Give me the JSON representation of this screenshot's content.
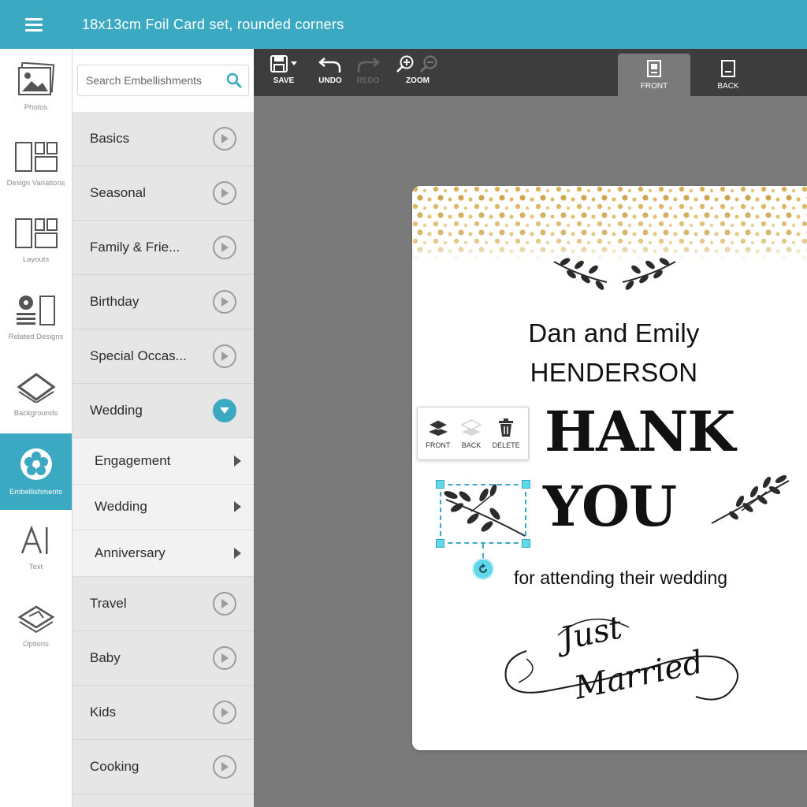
{
  "app": {
    "title": "18x13cm Foil Card set, rounded corners"
  },
  "rail": [
    {
      "label": "Photos",
      "icon": "photos-icon"
    },
    {
      "label": "Design Variations",
      "icon": "design-variations-icon"
    },
    {
      "label": "Layouts",
      "icon": "layouts-icon"
    },
    {
      "label": "Related Designs",
      "icon": "related-designs-icon"
    },
    {
      "label": "Backgrounds",
      "icon": "backgrounds-icon"
    },
    {
      "label": "Embellishments",
      "icon": "flower-icon",
      "active": true
    },
    {
      "label": "Text",
      "icon": "text-icon"
    },
    {
      "label": "Options",
      "icon": "options-icon"
    }
  ],
  "search": {
    "placeholder": "Search Embellishments"
  },
  "categories": {
    "basics": "Basics",
    "seasonal": "Seasonal",
    "family": "Family & Frie...",
    "birthday": "Birthday",
    "special": "Special Occas...",
    "wedding": "Wedding",
    "travel": "Travel",
    "baby": "Baby",
    "kids": "Kids",
    "cooking": "Cooking"
  },
  "wedding_sub": {
    "engagement": "Engagement",
    "wedding": "Wedding",
    "anniversary": "Anniversary"
  },
  "toolbar": {
    "save": "SAVE",
    "undo": "UNDO",
    "redo": "REDO",
    "zoom": "ZOOM",
    "front": "FRONT",
    "back": "BACK"
  },
  "card": {
    "line1": "Dan and Emily",
    "line2": "HENDERSON",
    "thank": "HANK",
    "you": "YOU",
    "attending": "for attending their wedding",
    "script1": "Just",
    "script2": "Married"
  },
  "popup": {
    "front": "FRONT",
    "back": "BACK",
    "delete": "DELETE"
  },
  "colors": {
    "accent": "#3aa9c1",
    "toolbar": "#3d3d3d",
    "canvas": "#7a7a7a",
    "foil_gold": "#d8b054"
  }
}
